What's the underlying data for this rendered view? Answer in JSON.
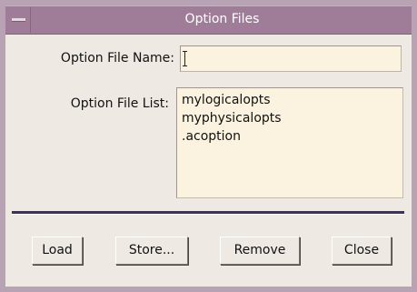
{
  "window": {
    "title": "Option Files"
  },
  "form": {
    "name_label": "Option File Name:",
    "name_value": "",
    "list_label": "Option File List:",
    "list_items": [
      "mylogicalopts",
      "myphysicalopts",
      ".acoption"
    ]
  },
  "buttons": {
    "load": "Load",
    "store": "Store...",
    "remove": "Remove",
    "close": "Close"
  },
  "colors": {
    "titlebar": "#9f7d99",
    "field_bg": "#fbf3df",
    "window_bg": "#efe9e4"
  }
}
